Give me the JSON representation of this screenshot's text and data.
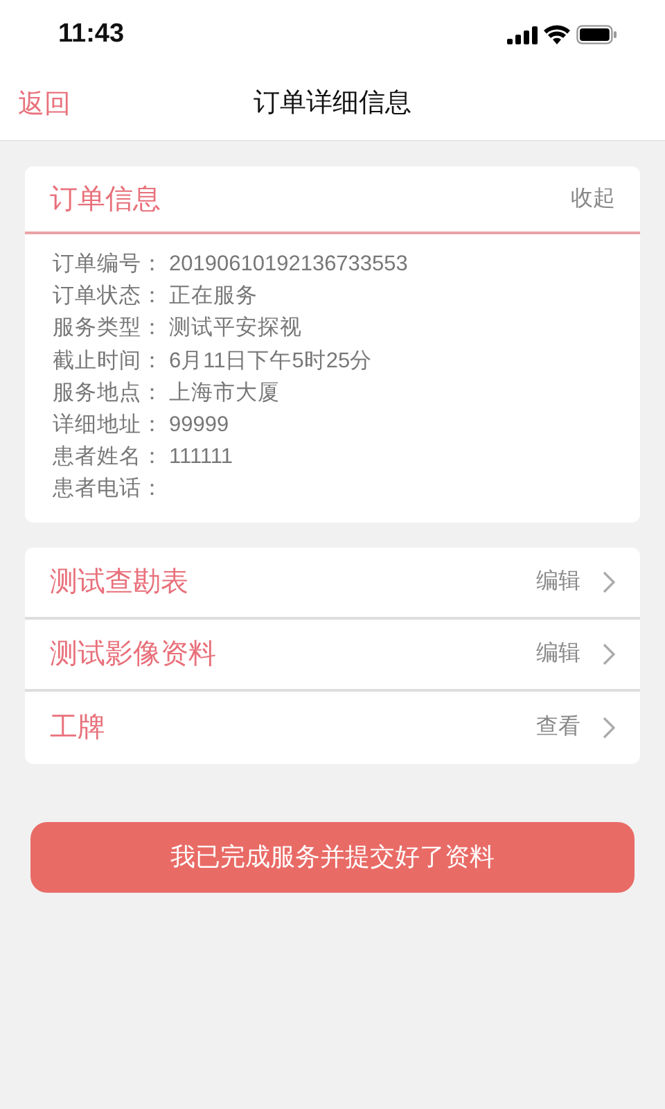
{
  "status_bar": {
    "time": "11:43"
  },
  "nav": {
    "back": "返回",
    "title": "订单详细信息"
  },
  "order_card": {
    "title": "订单信息",
    "toggle": "收起",
    "fields": [
      {
        "label": "订单编号：",
        "value": "20190610192136733553"
      },
      {
        "label": "订单状态：",
        "value": "正在服务"
      },
      {
        "label": "服务类型：",
        "value": "测试平安探视"
      },
      {
        "label": "截止时间：",
        "value": "6月11日下午5时25分"
      },
      {
        "label": "服务地点：",
        "value": "上海市大厦"
      },
      {
        "label": "详细地址：",
        "value": "99999"
      },
      {
        "label": "患者姓名：",
        "value": "111111"
      },
      {
        "label": "患者电话："
      }
    ]
  },
  "links": [
    {
      "title": "测试查勘表",
      "action": "编辑"
    },
    {
      "title": "测试影像资料",
      "action": "编辑"
    },
    {
      "title": "工牌",
      "action": "查看"
    }
  ],
  "submit_button": "我已完成服务并提交好了资料"
}
